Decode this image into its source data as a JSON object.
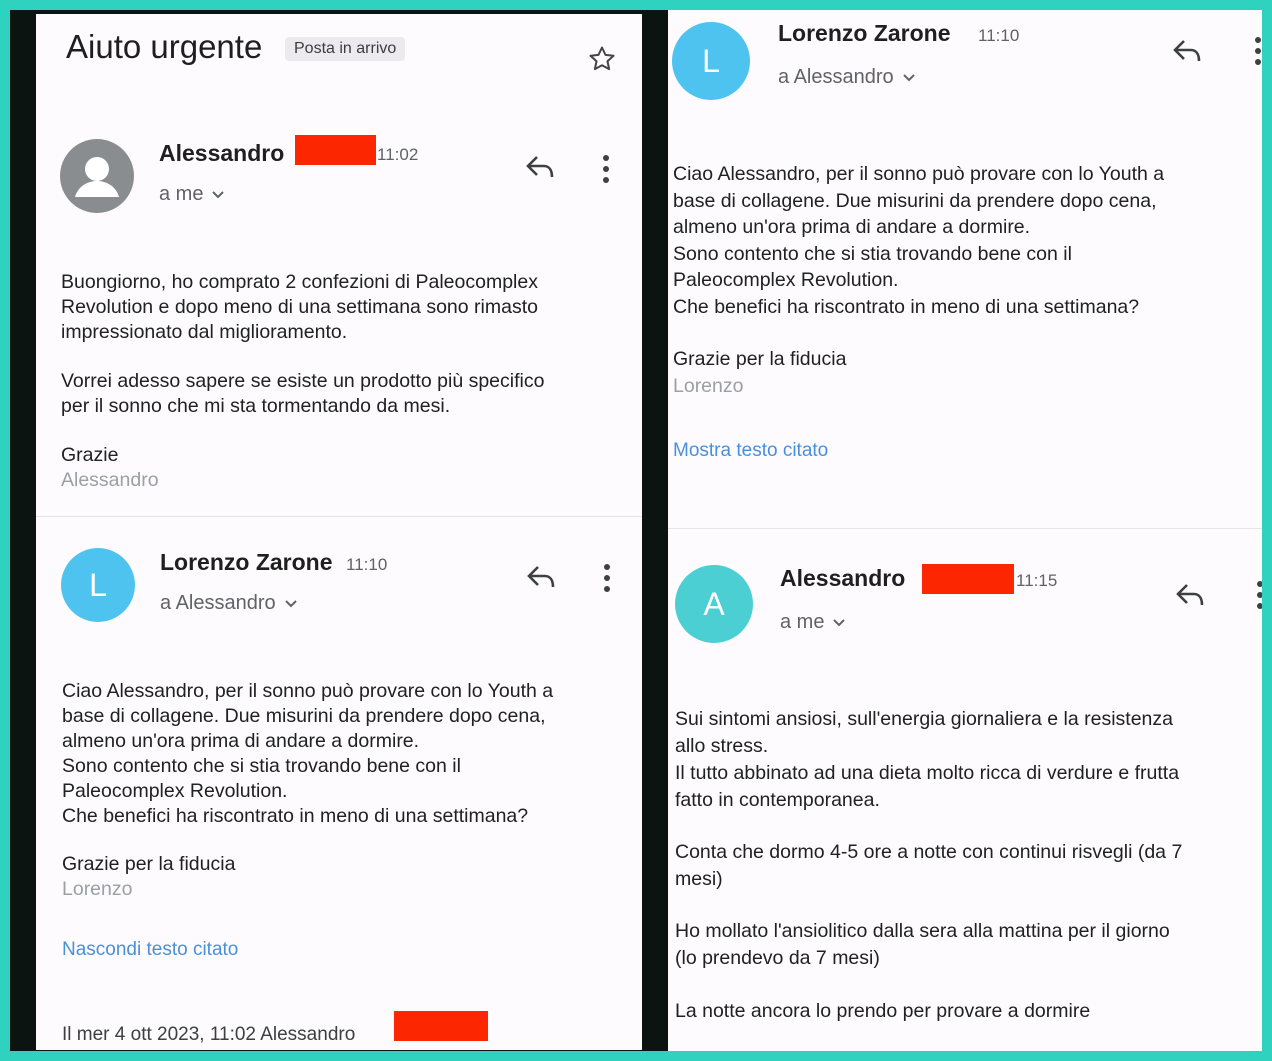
{
  "left_panel": {
    "subject": "Aiuto urgente",
    "label": "Posta in arrivo",
    "messages": [
      {
        "sender": "Alessandro",
        "time": "11:02",
        "recipient": "a me",
        "body": "Buongiorno, ho comprato 2 confezioni di Paleocomplex\nRevolution e dopo meno di una settimana sono rimasto\nimpressionato dal miglioramento.",
        "body2": "Vorrei adesso sapere se esiste un prodotto più specifico\nper il sonno che mi sta tormentando da mesi.",
        "signoff": "Grazie",
        "signature": "Alessandro"
      },
      {
        "sender": "Lorenzo Zarone",
        "time": "11:10",
        "avatar_letter": "L",
        "recipient": "a Alessandro",
        "body": "Ciao Alessandro, per il sonno può provare con lo Youth a\nbase di collagene. Due misurini da prendere dopo cena,\nalmeno un'ora prima di andare a dormire.\nSono contento che si stia trovando bene con il\nPaleocomplex Revolution.\nChe benefici ha riscontrato in meno di una settimana?",
        "signoff": "Grazie per la fiducia",
        "signature": "Lorenzo",
        "quote_link": "Nascondi testo citato",
        "quoted_header": "Il mer 4 ott 2023, 11:02 Alessandro"
      }
    ]
  },
  "right_panel": {
    "messages": [
      {
        "sender": "Lorenzo Zarone",
        "time": "11:10",
        "avatar_letter": "L",
        "recipient": "a Alessandro",
        "body": "Ciao Alessandro, per il sonno può provare con lo Youth a\nbase di collagene. Due misurini da prendere dopo cena,\nalmeno un'ora prima di andare a dormire.\nSono contento che si stia trovando bene con il\nPaleocomplex Revolution.\nChe benefici ha riscontrato in meno di una settimana?",
        "signoff": "Grazie per la fiducia",
        "signature": "Lorenzo",
        "quote_link": "Mostra testo citato"
      },
      {
        "sender": "Alessandro",
        "time": "11:15",
        "avatar_letter": "A",
        "recipient": "a me",
        "body": "Sui sintomi ansiosi, sull'energia giornaliera e la resistenza\nallo stress.\nIl tutto abbinato ad una dieta molto ricca di verdure e frutta\nfatto in contemporanea.",
        "body2": "Conta che dormo 4-5 ore a notte con continui risvegli (da 7\nmesi)",
        "body3": "Ho mollato l'ansiolitico dalla sera alla mattina per il giorno\n(lo prendevo da 7 mesi)",
        "body4": "La notte ancora lo prendo per provare a dormire"
      }
    ]
  },
  "colors": {
    "frame": "#2fd1bf",
    "redaction": "#fc2600",
    "link": "#4a90d9"
  }
}
